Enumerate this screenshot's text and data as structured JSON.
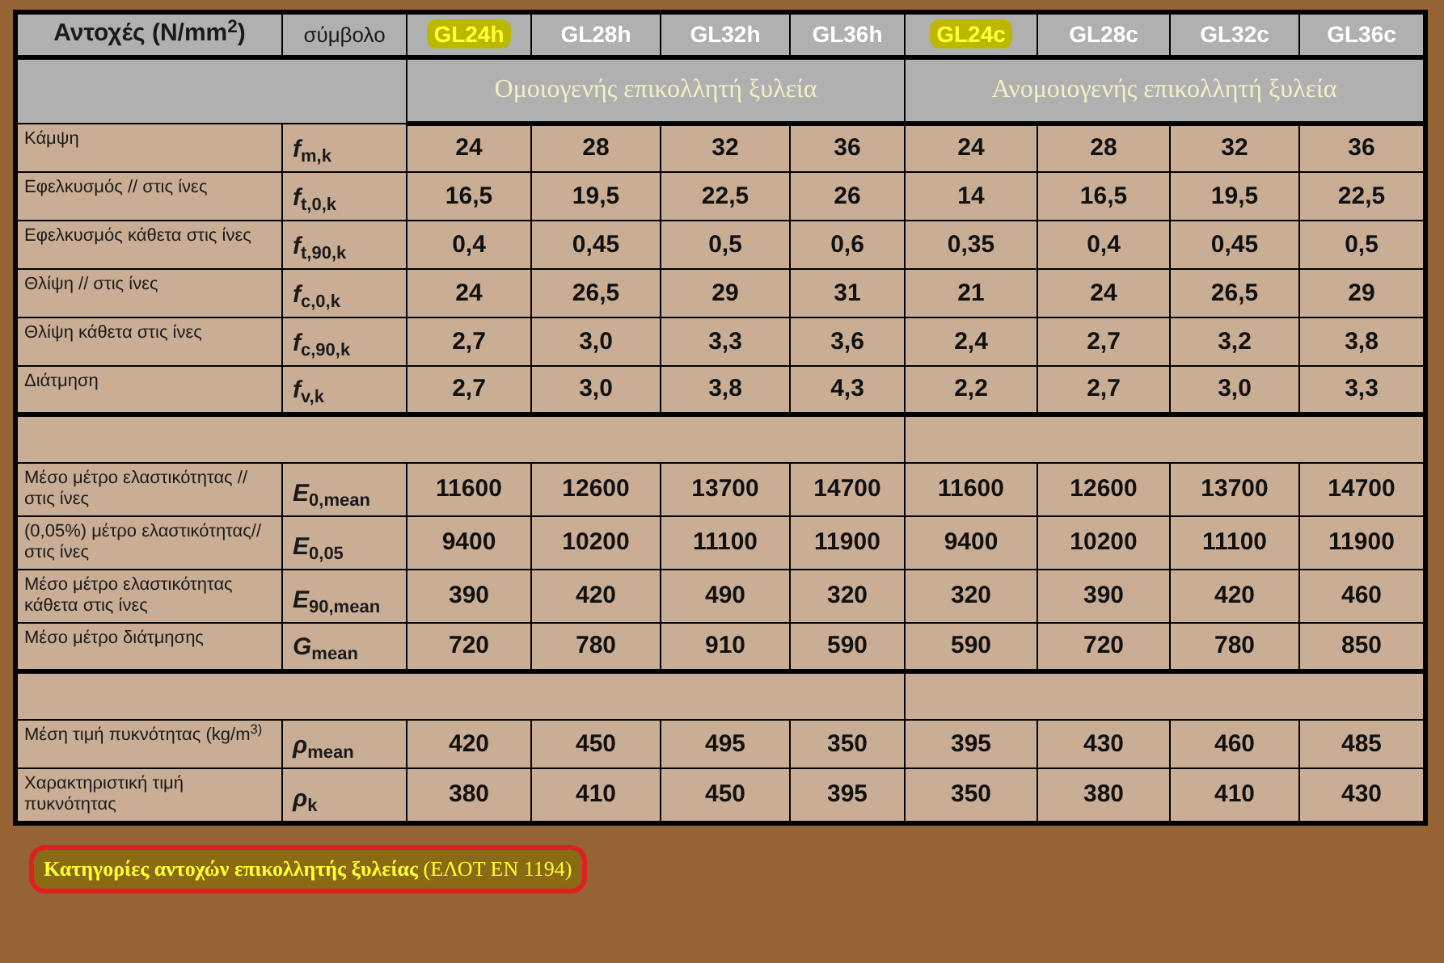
{
  "header": {
    "property_label": "Αντοχές  (N/mm$^{2}$)",
    "symbol_label": "σύμβολο",
    "grades": [
      {
        "label": "GL24h",
        "highlighted": true
      },
      {
        "label": "GL28h",
        "highlighted": false
      },
      {
        "label": "GL32h",
        "highlighted": false
      },
      {
        "label": "GL36h",
        "highlighted": false
      },
      {
        "label": "GL24c",
        "highlighted": true
      },
      {
        "label": "GL28c",
        "highlighted": false
      },
      {
        "label": "GL32c",
        "highlighted": false
      },
      {
        "label": "GL36c",
        "highlighted": false
      }
    ]
  },
  "groups": [
    {
      "label": "Ομοιογενής επικολλητή ξυλεία"
    },
    {
      "label": "Ανομοιογενής επικολλητή ξυλεία"
    }
  ],
  "sections": [
    {
      "rows": [
        {
          "property": "Κάμψη",
          "symbol": "*f*$_{m,k}$",
          "values": [
            "24",
            "28",
            "32",
            "36",
            "24",
            "28",
            "32",
            "36"
          ]
        },
        {
          "property": "Εφελκυσμός // στις ίνες",
          "symbol": "*f*$_{t,0,k}$",
          "values": [
            "16,5",
            "19,5",
            "22,5",
            "26",
            "14",
            "16,5",
            "19,5",
            "22,5"
          ]
        },
        {
          "property": "Εφελκυσμός κάθετα στις ίνες",
          "symbol": "*f*$_{t,90,k}$",
          "values": [
            "0,4",
            "0,45",
            "0,5",
            "0,6",
            "0,35",
            "0,4",
            "0,45",
            "0,5"
          ]
        },
        {
          "property": "Θλίψη  // στις ίνες",
          "symbol": "*f*$_{c,0,k}$",
          "values": [
            "24",
            "26,5",
            "29",
            "31",
            "21",
            "24",
            "26,5",
            "29"
          ]
        },
        {
          "property": "Θλίψη κάθετα στις ίνες",
          "symbol": "*f*$_{c,90,k}$",
          "values": [
            "2,7",
            "3,0",
            "3,3",
            "3,6",
            "2,4",
            "2,7",
            "3,2",
            "3,8"
          ]
        },
        {
          "property": "Διάτμηση",
          "symbol": "*f*$_{v,k}$",
          "values": [
            "2,7",
            "3,0",
            "3,8",
            "4,3",
            "2,2",
            "2,7",
            "3,0",
            "3,3"
          ]
        }
      ]
    },
    {
      "rows": [
        {
          "property": "Μέσο μέτρο ελαστικότητας // στις ίνες",
          "symbol": "*E*$_{0,mean}$",
          "values": [
            "11600",
            "12600",
            "13700",
            "14700",
            "11600",
            "12600",
            "13700",
            "14700"
          ]
        },
        {
          "property": "(0,05%) μέτρο ελαστικότητας// στις ίνες",
          "symbol": "*E*$_{0,05}$",
          "values": [
            "9400",
            "10200",
            "11100",
            "11900",
            "9400",
            "10200",
            "11100",
            "11900"
          ]
        },
        {
          "property": "Μέσο μέτρο ελαστικότητας κάθετα στις ίνες",
          "symbol": "*E*$_{90,mean}$",
          "values": [
            "390",
            "420",
            "490",
            "320",
            "320",
            "390",
            "420",
            "460"
          ]
        },
        {
          "property": "Μέσο μέτρο διάτμησης",
          "symbol": "*G*$_{mean}$",
          "values": [
            "720",
            "780",
            "910",
            "590",
            "590",
            "720",
            "780",
            "850"
          ]
        }
      ]
    },
    {
      "rows": [
        {
          "property": "Μέση τιμή πυκνότητας (kg/m$^{3)}$",
          "symbol": "*ρ*$_{mean}$",
          "values": [
            "420",
            "450",
            "495",
            "350",
            "395",
            "430",
            "460",
            "485"
          ]
        },
        {
          "property": "Χαρακτηριστική τιμή πυκνότητας",
          "symbol": "*ρ*$_{k}$",
          "values": [
            "380",
            "410",
            "450",
            "395",
            "350",
            "380",
            "410",
            "430"
          ]
        }
      ]
    }
  ],
  "caption": "**Κατηγορίες αντοχών επικολλητής ξυλείας** (ΕΛΟΤ ΕΝ 1194)"
}
